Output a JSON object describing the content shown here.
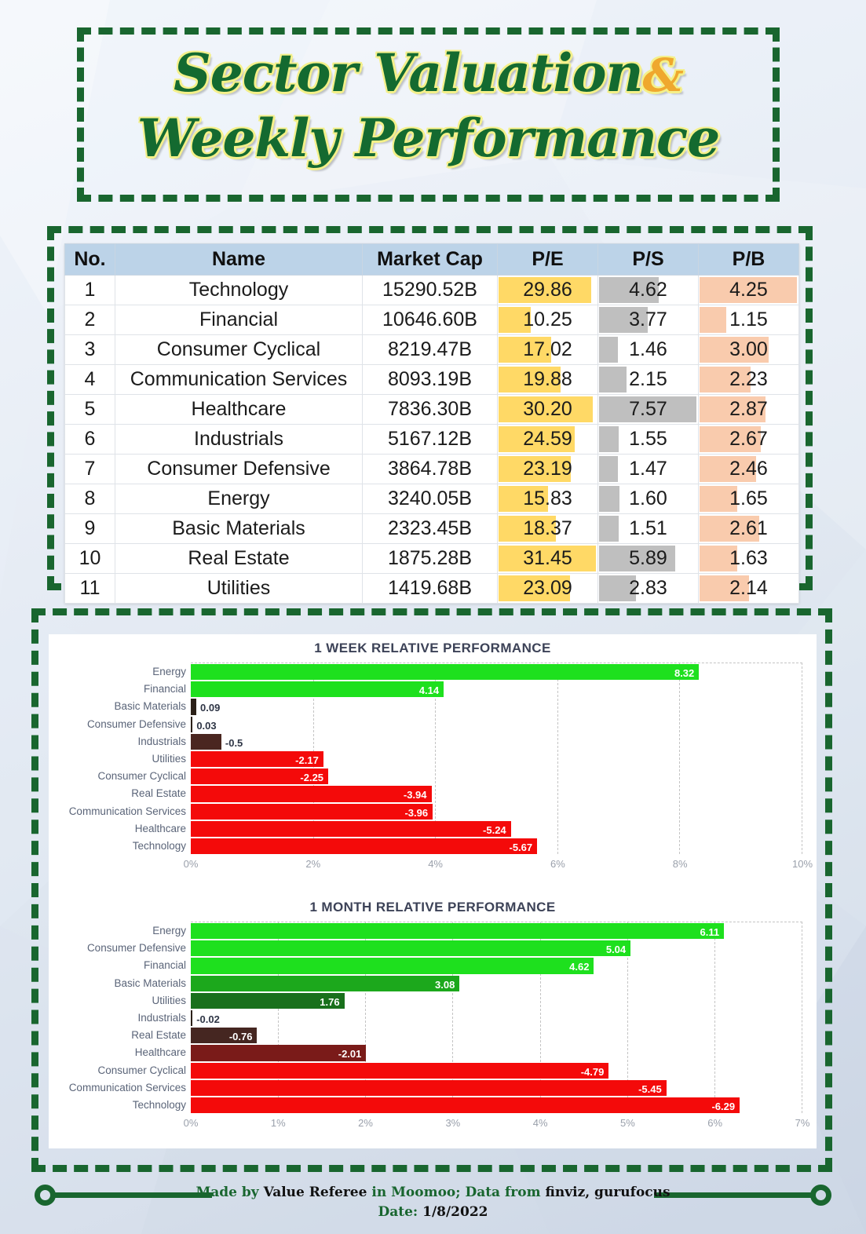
{
  "title": {
    "line1": "Sector Valuation",
    "amp": "&",
    "line2": "Weekly Performance"
  },
  "table": {
    "headers": [
      "No.",
      "Name",
      "Market Cap",
      "P/E",
      "P/S",
      "P/B"
    ],
    "bar_colors": {
      "pe": "#ffd966",
      "ps": "#bfbfbf",
      "pb": "#f9cbad"
    },
    "rows": [
      {
        "no": "1",
        "name": "Technology",
        "cap": "15290.52B",
        "pe": "29.86",
        "ps": "4.62",
        "pb": "4.25"
      },
      {
        "no": "2",
        "name": "Financial",
        "cap": "10646.60B",
        "pe": "10.25",
        "ps": "3.77",
        "pb": "1.15"
      },
      {
        "no": "3",
        "name": "Consumer Cyclical",
        "cap": "8219.47B",
        "pe": "17.02",
        "ps": "1.46",
        "pb": "3.00"
      },
      {
        "no": "4",
        "name": "Communication Services",
        "cap": "8093.19B",
        "pe": "19.88",
        "ps": "2.15",
        "pb": "2.23"
      },
      {
        "no": "5",
        "name": "Healthcare",
        "cap": "7836.30B",
        "pe": "30.20",
        "ps": "7.57",
        "pb": "2.87"
      },
      {
        "no": "6",
        "name": "Industrials",
        "cap": "5167.12B",
        "pe": "24.59",
        "ps": "1.55",
        "pb": "2.67"
      },
      {
        "no": "7",
        "name": "Consumer Defensive",
        "cap": "3864.78B",
        "pe": "23.19",
        "ps": "1.47",
        "pb": "2.46"
      },
      {
        "no": "8",
        "name": "Energy",
        "cap": "3240.05B",
        "pe": "15.83",
        "ps": "1.60",
        "pb": "1.65"
      },
      {
        "no": "9",
        "name": "Basic Materials",
        "cap": "2323.45B",
        "pe": "18.37",
        "ps": "1.51",
        "pb": "2.61"
      },
      {
        "no": "10",
        "name": "Real Estate",
        "cap": "1875.28B",
        "pe": "31.45",
        "ps": "5.89",
        "pb": "1.63"
      },
      {
        "no": "11",
        "name": "Utilities",
        "cap": "1419.68B",
        "pe": "23.09",
        "ps": "2.83",
        "pb": "2.14"
      }
    ]
  },
  "chart_data": [
    {
      "id": "week",
      "type": "bar",
      "orientation": "horizontal",
      "title": "1 WEEK RELATIVE PERFORMANCE",
      "xlabel": "",
      "ylabel": "",
      "xlim": [
        0,
        10
      ],
      "ticks": [
        "0%",
        "2%",
        "4%",
        "6%",
        "8%",
        "10%"
      ],
      "tick_values": [
        0,
        2,
        4,
        6,
        8,
        10
      ],
      "grid": true,
      "legend": "none",
      "note": "bar length uses absolute value of the data point; axis is a magnitude scale 0-10%",
      "categories": [
        "Energy",
        "Financial",
        "Basic Materials",
        "Consumer Defensive",
        "Industrials",
        "Utilities",
        "Consumer Cyclical",
        "Real Estate",
        "Communication Services",
        "Healthcare",
        "Technology"
      ],
      "values": [
        8.32,
        4.14,
        0.09,
        0.03,
        -0.5,
        -2.17,
        -2.25,
        -3.94,
        -3.96,
        -5.24,
        -5.67
      ],
      "labels": [
        "8.32",
        "4.14",
        "0.09",
        "0.03",
        "-0.5",
        "-2.17",
        "-2.25",
        "-3.94",
        "-3.96",
        "-5.24",
        "-5.67"
      ],
      "colors": [
        "#1ee01e",
        "#1ee01e",
        "#2b2018",
        "#2b2018",
        "#4a2620",
        "#f40a0a",
        "#f40a0a",
        "#f40a0a",
        "#f40a0a",
        "#f40a0a",
        "#f40a0a"
      ],
      "label_inside": [
        true,
        true,
        false,
        false,
        false,
        true,
        true,
        true,
        true,
        true,
        true
      ]
    },
    {
      "id": "month",
      "type": "bar",
      "orientation": "horizontal",
      "title": "1 MONTH RELATIVE PERFORMANCE",
      "xlabel": "",
      "ylabel": "",
      "xlim": [
        0,
        7
      ],
      "ticks": [
        "0%",
        "1%",
        "2%",
        "3%",
        "4%",
        "5%",
        "6%",
        "7%"
      ],
      "tick_values": [
        0,
        1,
        2,
        3,
        4,
        5,
        6,
        7
      ],
      "grid": true,
      "legend": "none",
      "note": "bar length uses absolute value of the data point; axis is a magnitude scale 0-7%",
      "categories": [
        "Energy",
        "Consumer Defensive",
        "Financial",
        "Basic Materials",
        "Utilities",
        "Industrials",
        "Real Estate",
        "Healthcare",
        "Consumer Cyclical",
        "Communication Services",
        "Technology"
      ],
      "values": [
        6.11,
        5.04,
        4.62,
        3.08,
        1.76,
        -0.02,
        -0.76,
        -2.01,
        -4.79,
        -5.45,
        -6.29
      ],
      "labels": [
        "6.11",
        "5.04",
        "4.62",
        "3.08",
        "1.76",
        "-0.02",
        "-0.76",
        "-2.01",
        "-4.79",
        "-5.45",
        "-6.29"
      ],
      "colors": [
        "#1ee01e",
        "#1ee01e",
        "#1ee01e",
        "#1ca81c",
        "#19701c",
        "#2b2018",
        "#452621",
        "#7a1b19",
        "#f40a0a",
        "#f40a0a",
        "#f40a0a"
      ],
      "label_inside": [
        true,
        true,
        true,
        true,
        true,
        false,
        true,
        true,
        true,
        true,
        true
      ]
    }
  ],
  "footer": {
    "line1_a": "Made by ",
    "line1_b": "Value Referee",
    "line1_c": " in Moomoo; Data from ",
    "line1_d": "finviz, gurufocus",
    "line2_a": "Date: ",
    "line2_b": "1/8/2022"
  }
}
